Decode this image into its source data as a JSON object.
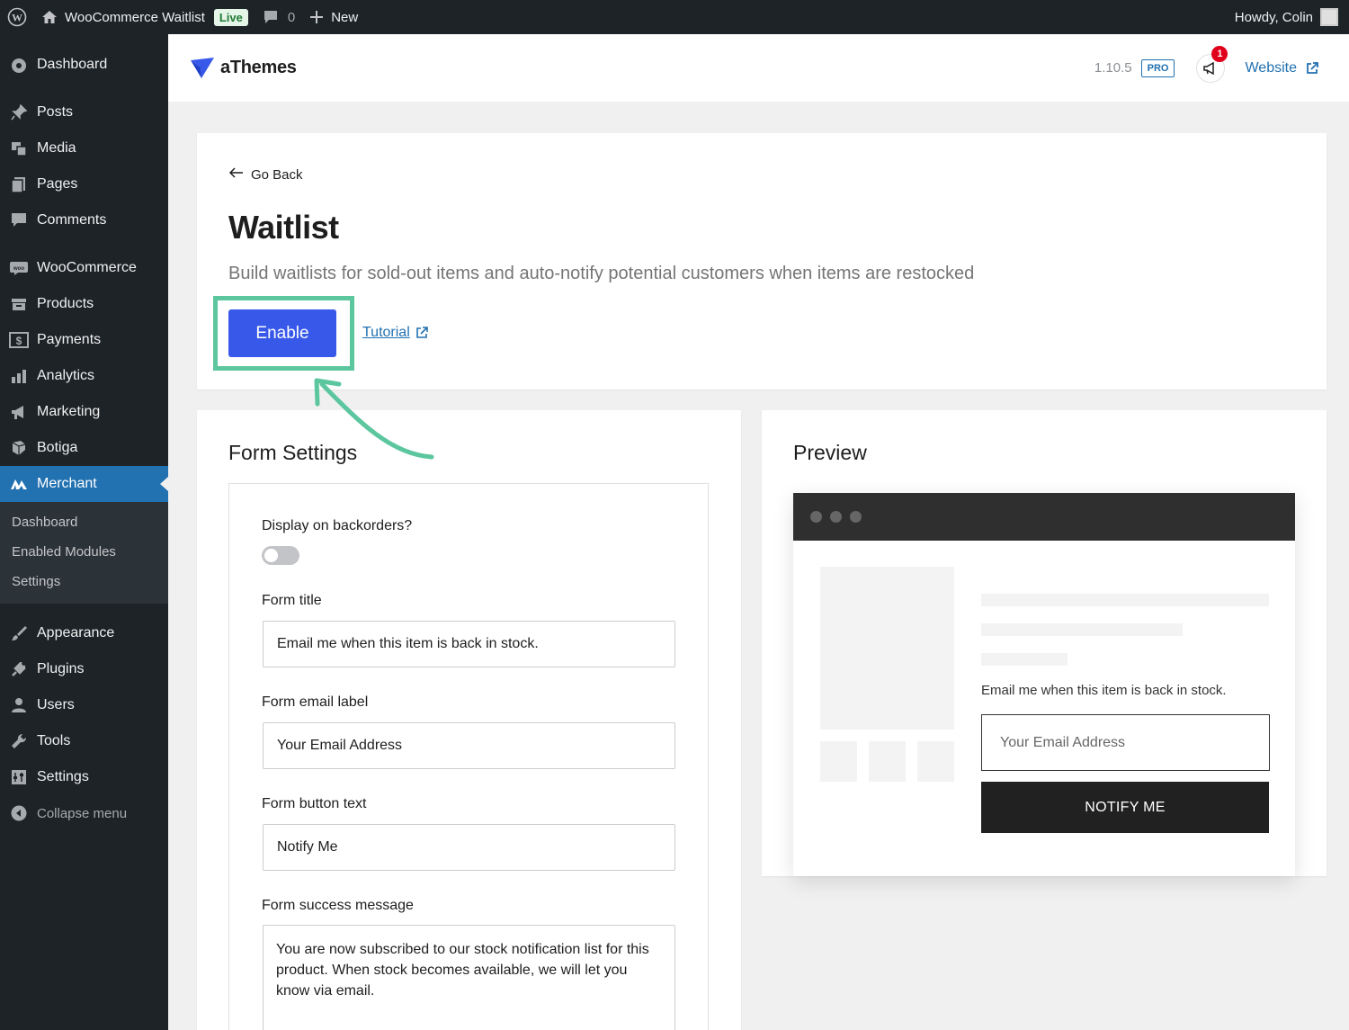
{
  "adminbar": {
    "site_name": "WooCommerce Waitlist",
    "live_badge": "Live",
    "comments_count": "0",
    "new_label": "New",
    "greeting": "Howdy, Colin"
  },
  "sidebar": {
    "items": [
      {
        "label": "Dashboard",
        "icon": "dashboard-icon"
      },
      {
        "label": "Posts",
        "icon": "pin-icon"
      },
      {
        "label": "Media",
        "icon": "media-icon"
      },
      {
        "label": "Pages",
        "icon": "pages-icon"
      },
      {
        "label": "Comments",
        "icon": "comment-icon"
      },
      {
        "label": "WooCommerce",
        "icon": "woo-icon"
      },
      {
        "label": "Products",
        "icon": "archive-icon"
      },
      {
        "label": "Payments",
        "icon": "dollar-icon"
      },
      {
        "label": "Analytics",
        "icon": "bar-chart-icon"
      },
      {
        "label": "Marketing",
        "icon": "megaphone-icon"
      },
      {
        "label": "Botiga",
        "icon": "botiga-icon"
      },
      {
        "label": "Merchant",
        "icon": "merchant-icon"
      },
      {
        "label": "Appearance",
        "icon": "brush-icon"
      },
      {
        "label": "Plugins",
        "icon": "plug-icon"
      },
      {
        "label": "Users",
        "icon": "user-icon"
      },
      {
        "label": "Tools",
        "icon": "wrench-icon"
      },
      {
        "label": "Settings",
        "icon": "settings-icon"
      }
    ],
    "submenu": [
      "Dashboard",
      "Enabled Modules",
      "Settings"
    ],
    "collapse_label": "Collapse menu"
  },
  "header": {
    "brand": "aThemes",
    "version": "1.10.5",
    "pro_badge": "PRO",
    "notification_count": "1",
    "website_label": "Website"
  },
  "module": {
    "go_back": "Go Back",
    "title": "Waitlist",
    "description": "Build waitlists for sold-out items and auto-notify potential customers when items are restocked",
    "enable_label": "Enable",
    "tutorial_label": "Tutorial"
  },
  "form": {
    "title": "Form Settings",
    "backorders_label": "Display on backorders?",
    "backorders_enabled": false,
    "form_title_label": "Form title",
    "form_title_value": "Email me when this item is back in stock.",
    "email_label_label": "Form email label",
    "email_label_value": "Your Email Address",
    "button_text_label": "Form button text",
    "button_text_value": "Notify Me",
    "success_label": "Form success message",
    "success_value": "You are now subscribed to our stock notification list for this product. When stock becomes available, we will let you know via email."
  },
  "preview": {
    "title": "Preview",
    "form_text": "Email me when this item is back in stock.",
    "email_placeholder": "Your Email Address",
    "button_label": "NOTIFY ME"
  },
  "colors": {
    "accent": "#3858e9",
    "highlight": "#5cc69e",
    "sidebar_bg": "#1d2327",
    "active_menu": "#2271b1"
  }
}
